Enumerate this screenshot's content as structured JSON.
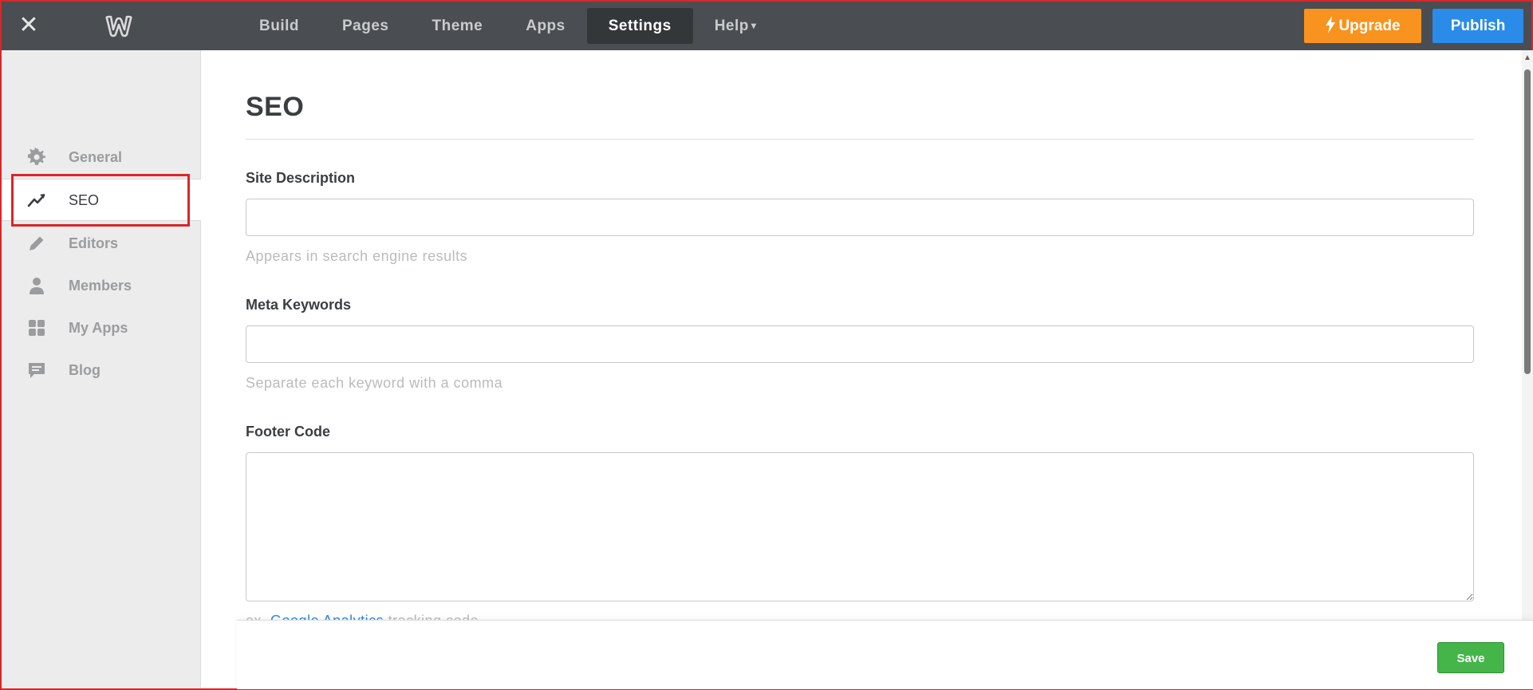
{
  "topbar": {
    "close_icon": "close-icon",
    "logo_icon": "weebly-logo",
    "nav": [
      {
        "label": "Build",
        "active": false
      },
      {
        "label": "Pages",
        "active": false
      },
      {
        "label": "Theme",
        "active": false
      },
      {
        "label": "Apps",
        "active": false
      },
      {
        "label": "Settings",
        "active": true
      },
      {
        "label": "Help",
        "active": false,
        "caret": "▾"
      }
    ],
    "upgrade_label": "Upgrade",
    "upgrade_icon": "lightning-icon",
    "publish_label": "Publish",
    "colors": {
      "bar": "#4a4d51",
      "upgrade": "#f7931e",
      "publish": "#2a8ce8"
    }
  },
  "sidebar": {
    "items": [
      {
        "label": "General",
        "icon": "gear-icon",
        "active": false
      },
      {
        "label": "SEO",
        "icon": "trend-line-icon",
        "active": true
      },
      {
        "label": "Editors",
        "icon": "pencil-icon",
        "active": false
      },
      {
        "label": "Members",
        "icon": "person-icon",
        "active": false
      },
      {
        "label": "My Apps",
        "icon": "apps-grid-icon",
        "active": false
      },
      {
        "label": "Blog",
        "icon": "comment-icon",
        "active": false
      }
    ]
  },
  "main": {
    "title": "SEO",
    "fields": {
      "site_description": {
        "label": "Site Description",
        "value": "",
        "help": "Appears in search engine results"
      },
      "meta_keywords": {
        "label": "Meta Keywords",
        "value": "",
        "help": "Separate each keyword with a comma"
      },
      "footer_code": {
        "label": "Footer Code",
        "value": "",
        "help_prefix": "ex.",
        "help_link": "Google Analytics",
        "help_suffix": "tracking code"
      }
    }
  },
  "footer": {
    "save_label": "Save",
    "save_color": "#45b54a"
  }
}
